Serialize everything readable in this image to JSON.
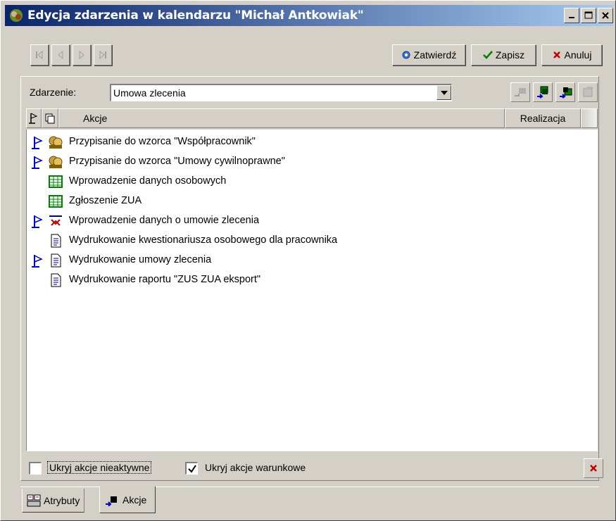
{
  "window": {
    "title": "Edycja zdarzenia w kalendarzu \"Michał Antkowiak\""
  },
  "toolbar": {
    "confirm_label": "Zatwierdź",
    "save_label": "Zapisz",
    "cancel_label": "Anuluj"
  },
  "event": {
    "label": "Zdarzenie:",
    "value": "Umowa zlecenia"
  },
  "list": {
    "columns": {
      "actions": "Akcje",
      "realization": "Realizacja"
    },
    "rows": [
      {
        "flag": true,
        "icon": "people-icon",
        "text": "Przypisanie do wzorca \"Współpracownik\""
      },
      {
        "flag": true,
        "icon": "people-icon",
        "text": "Przypisanie do wzorca \"Umowy cywilnoprawne\""
      },
      {
        "flag": false,
        "icon": "grid-icon",
        "text": "Wprowadzenie danych osobowych"
      },
      {
        "flag": false,
        "icon": "grid-icon",
        "text": "Zgłoszenie ZUA"
      },
      {
        "flag": true,
        "icon": "transfer-icon",
        "text": "Wprowadzenie danych o umowie zlecenia"
      },
      {
        "flag": false,
        "icon": "document-icon",
        "text": "Wydrukowanie kwestionariusza osobowego dla pracownika"
      },
      {
        "flag": true,
        "icon": "document-icon",
        "text": "Wydrukowanie umowy zlecenia"
      },
      {
        "flag": false,
        "icon": "document-icon",
        "text": "Wydrukowanie raportu \"ZUS ZUA eksport\""
      }
    ]
  },
  "options": {
    "hide_inactive_label": "Ukryj akcje nieaktywne",
    "hide_inactive_checked": false,
    "hide_conditional_label": "Ukryj akcje warunkowe",
    "hide_conditional_checked": true
  },
  "tabs": [
    {
      "label": "Atrybuty",
      "active": false
    },
    {
      "label": "Akcje",
      "active": true
    }
  ],
  "colors": {
    "title_start": "#0a246a",
    "title_end": "#a6caf0",
    "flag_blue": "#0000c0",
    "grid_green": "#008000",
    "delete_red": "#c00000"
  }
}
